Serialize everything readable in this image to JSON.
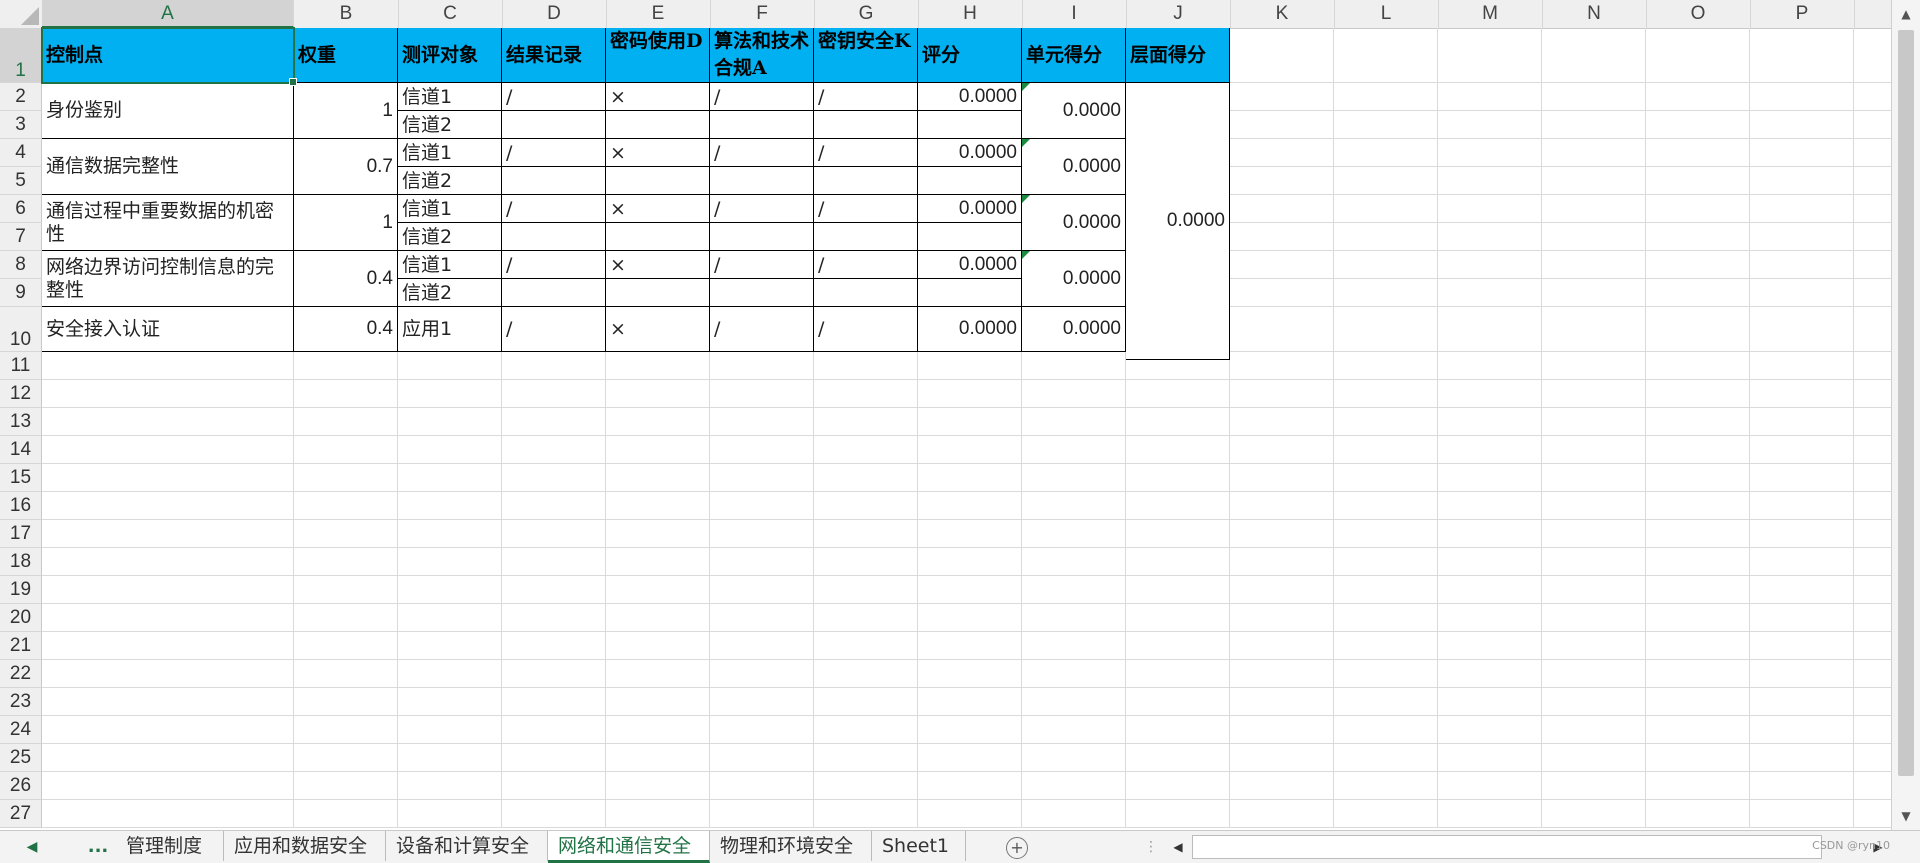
{
  "columns": [
    "A",
    "B",
    "C",
    "D",
    "E",
    "F",
    "G",
    "H",
    "I",
    "J",
    "K",
    "L",
    "M",
    "N",
    "O",
    "P"
  ],
  "rows": [
    "1",
    "2",
    "3",
    "4",
    "5",
    "6",
    "7",
    "8",
    "9",
    "10",
    "11",
    "12",
    "13",
    "14",
    "15",
    "16",
    "17",
    "18",
    "19",
    "20",
    "21",
    "22",
    "23",
    "24",
    "25",
    "26",
    "27"
  ],
  "active_cell": "A1",
  "header": {
    "control_point": "控制点",
    "weight": "权重",
    "eval_object": "测评对象",
    "result_record": "结果记录",
    "crypto_use": "密码使用D",
    "algo_compliance": "算法和技术合规A",
    "key_security": "密钥安全K",
    "score": "评分",
    "unit_score": "单元得分",
    "layer_score": "层面得分"
  },
  "table": [
    {
      "control_point": "身份鉴别",
      "weight": "1",
      "objects": [
        "信道1",
        "信道2"
      ],
      "record": "/",
      "crypto": "×",
      "algo": "/",
      "key": "/",
      "score": "0.0000",
      "unit_score": "0.0000",
      "flag": true
    },
    {
      "control_point": "通信数据完整性",
      "weight": "0.7",
      "objects": [
        "信道1",
        "信道2"
      ],
      "record": "/",
      "crypto": "×",
      "algo": "/",
      "key": "/",
      "score": "0.0000",
      "unit_score": "0.0000",
      "flag": true
    },
    {
      "control_point": "通信过程中重要数据的机密性",
      "weight": "1",
      "objects": [
        "信道1",
        "信道2"
      ],
      "record": "/",
      "crypto": "×",
      "algo": "/",
      "key": "/",
      "score": "0.0000",
      "unit_score": "0.0000",
      "flag": true
    },
    {
      "control_point": "网络边界访问控制信息的完整性",
      "weight": "0.4",
      "objects": [
        "信道1",
        "信道2"
      ],
      "record": "/",
      "crypto": "×",
      "algo": "/",
      "key": "/",
      "score": "0.0000",
      "unit_score": "0.0000",
      "flag": true
    },
    {
      "control_point": "安全接入认证",
      "weight": "0.4",
      "objects": [
        "应用1"
      ],
      "record": "/",
      "crypto": "×",
      "algo": "/",
      "key": "/",
      "score": "0.0000",
      "unit_score": "0.0000",
      "flag": false
    }
  ],
  "layer_score": "0.0000",
  "sheet_tabs": [
    "管理制度",
    "应用和数据安全",
    "设备和计算安全",
    "网络和通信安全",
    "物理和环境安全",
    "Sheet1"
  ],
  "active_tab": "网络和通信安全",
  "tab_nav": {
    "prev": "◀",
    "more": "...",
    "add": "+"
  },
  "watermark": "CSDN @ryn10",
  "colors": {
    "header_fill": "#00b0f0",
    "accent": "#217346",
    "comment_flag": "#1a8a3c"
  }
}
